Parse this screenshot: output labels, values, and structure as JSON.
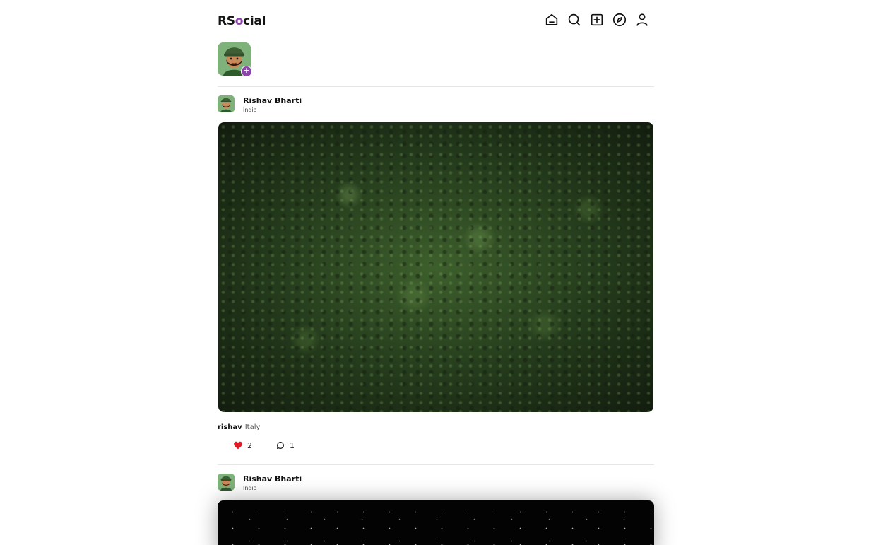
{
  "brand": {
    "prefix": "RS",
    "accent": "o",
    "suffix": "cial",
    "accent_color": "#8e44ad"
  },
  "nav": [
    {
      "name": "home-icon"
    },
    {
      "name": "search-icon"
    },
    {
      "name": "create-post-icon"
    },
    {
      "name": "explore-icon"
    },
    {
      "name": "profile-icon"
    }
  ],
  "stories": {
    "add_symbol": "+"
  },
  "posts": [
    {
      "user": "Rishav Bharti",
      "location": "India",
      "caption_user": "rishav",
      "caption_text": "Italy",
      "likes": "2",
      "comments": "1",
      "liked": true,
      "like_color": "#e01b24"
    },
    {
      "user": "Rishav Bharti",
      "location": "India"
    }
  ]
}
